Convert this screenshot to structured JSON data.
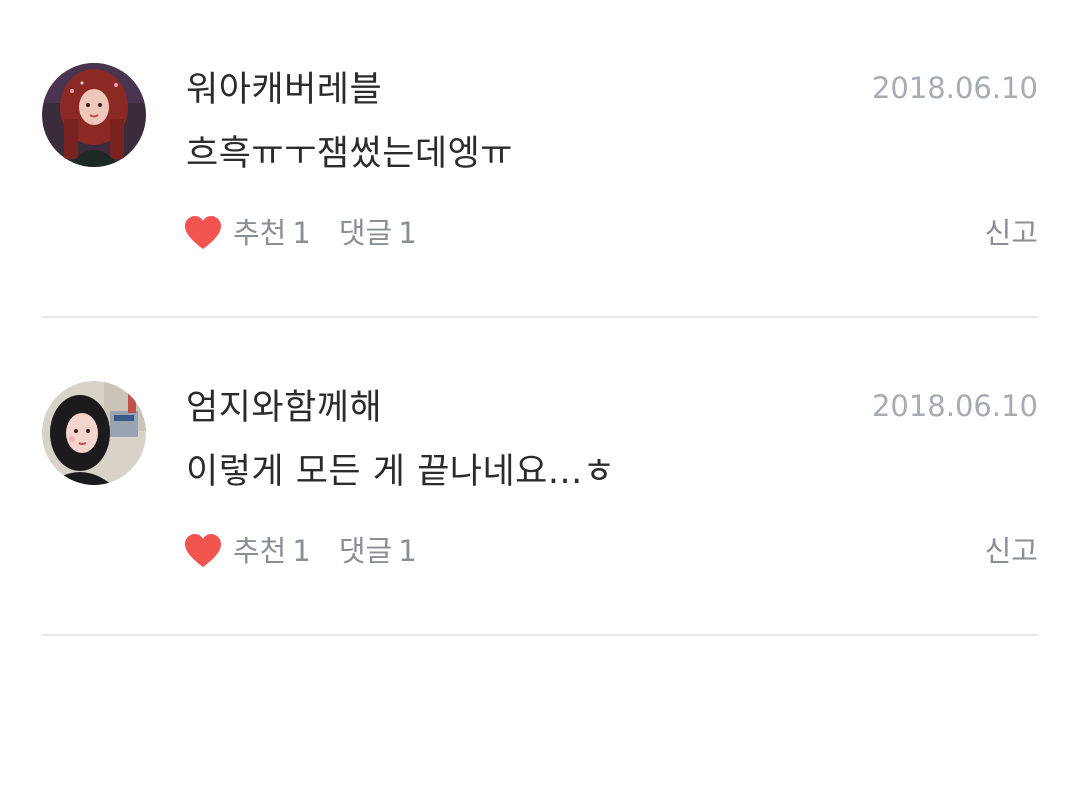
{
  "comments": [
    {
      "username": "워아캐버레블",
      "date": "2018.06.10",
      "text": "흐흑ㅠㅜ잼썼는데엥ㅠ",
      "like_label": "추천",
      "like_count": "1",
      "reply_label": "댓글",
      "reply_count": "1",
      "report_label": "신고"
    },
    {
      "username": "엄지와함께해",
      "date": "2018.06.10",
      "text": "이렇게 모든 게 끝나네요...ㅎ",
      "like_label": "추천",
      "like_count": "1",
      "reply_label": "댓글",
      "reply_count": "1",
      "report_label": "신고"
    }
  ],
  "colors": {
    "heart": "#f2544f",
    "divider": "#e7e8ea",
    "meta_text": "#8a8f96",
    "date_text": "#a7acb3",
    "primary_text": "#2b2b2b"
  }
}
